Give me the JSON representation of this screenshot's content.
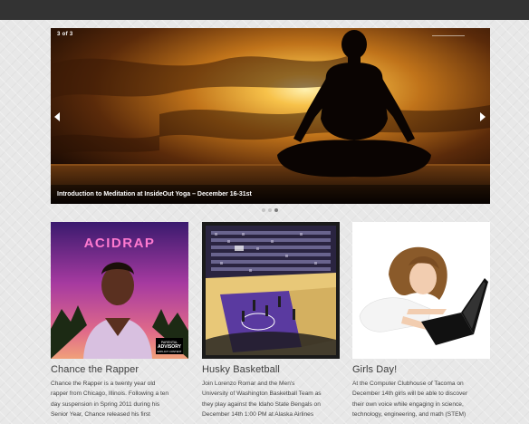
{
  "slider": {
    "counter_current": "3",
    "counter_sep": "of",
    "counter_total": "3",
    "caption": "Introduction to Meditation at InsideOut Yoga – December 16-31st",
    "dots": [
      {
        "active": false
      },
      {
        "active": false
      },
      {
        "active": true
      }
    ]
  },
  "cards": [
    {
      "title": "Chance the Rapper",
      "image_text": "ACIDRAP",
      "image_badge_line1": "PARENTAL",
      "image_badge_line2": "ADVISORY",
      "image_badge_line3": "EXPLICIT CONTENT",
      "lines": [
        "Chance the Rapper is a twenty year old",
        "rapper from Chicago, Illinois. Following a ten",
        "day suspension in Spring 2011 during his",
        "Senior Year, Chance released his first"
      ]
    },
    {
      "title": "Husky Basketball",
      "lines": [
        "Join Lorenzo Romar and the Men's",
        "University of Washington Basketball Team as",
        "they play against the Idaho State Bengals on",
        "December 14th 1:00 PM at Alaska Airlines"
      ]
    },
    {
      "title": "Girls Day!",
      "lines": [
        "At the Computer Clubhouse of Tacoma on",
        "December 14th girls will be able to discover",
        "their own voice while engaging in science,",
        "technology, engineering, and math (STEM)"
      ]
    }
  ],
  "colors": {
    "topbar": "#333333",
    "background": "#e8e8e8",
    "title_text": "#3c3c3c",
    "body_text": "#444444"
  }
}
